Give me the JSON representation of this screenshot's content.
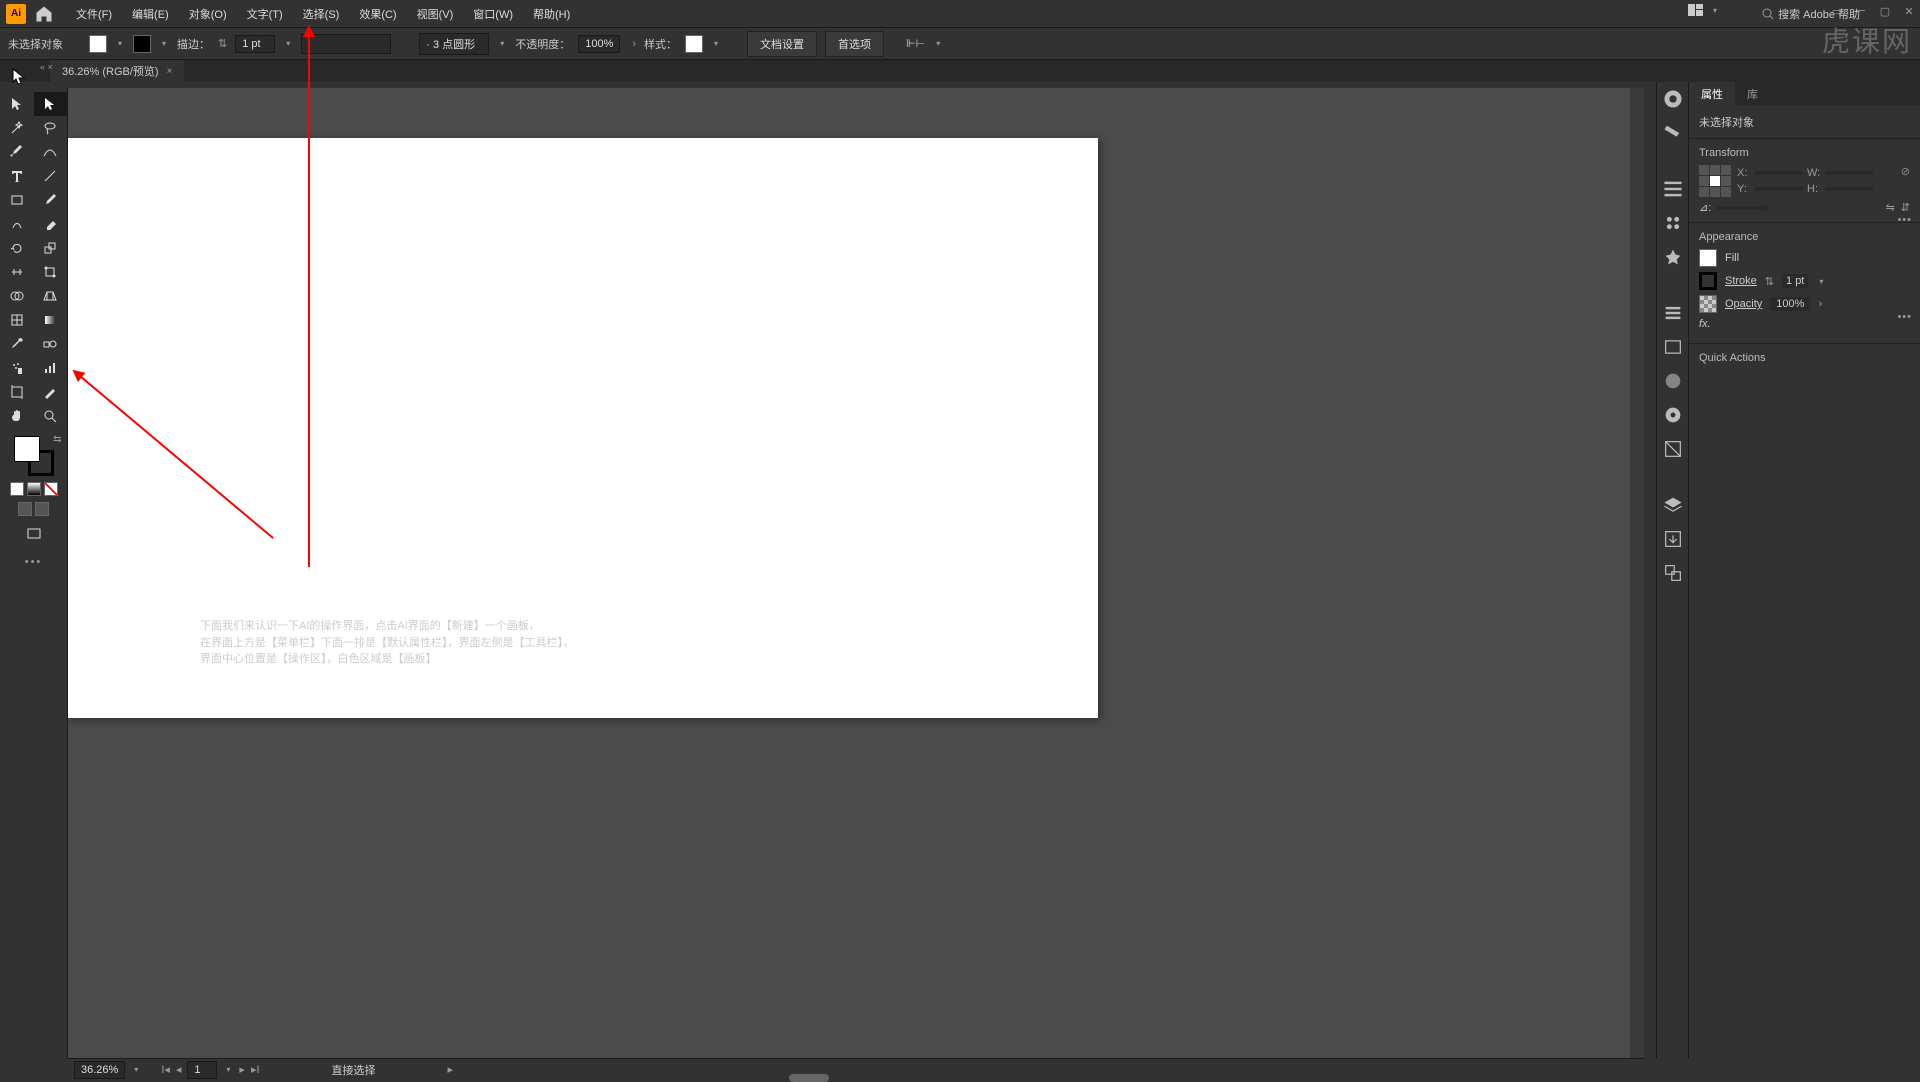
{
  "menu": {
    "file": "文件(F)",
    "edit": "编辑(E)",
    "object": "对象(O)",
    "type": "文字(T)",
    "select": "选择(S)",
    "effect": "效果(C)",
    "view": "视图(V)",
    "window": "窗口(W)",
    "help": "帮助(H)"
  },
  "search": {
    "placeholder": "搜索 Adobe 帮助"
  },
  "watermark": "虎课网",
  "control": {
    "noSel": "未选择对象",
    "stroke": "描边：",
    "strokeVal": "1 pt",
    "brushLabel": "· 3 点圆形",
    "opacity": "不透明度：",
    "opacityVal": "100%",
    "style": "样式：",
    "docSetup": "文档设置",
    "prefs": "首选项"
  },
  "doctab": {
    "title": "36.26% (RGB/预览)"
  },
  "status": {
    "zoom": "36.26%",
    "page": "1",
    "tool": "直接选择"
  },
  "panel": {
    "tabProps": "属性",
    "tabLib": "库",
    "noSel": "未选择对象",
    "transform": "Transform",
    "x": "X:",
    "y": "Y:",
    "w": "W:",
    "h": "H:",
    "angle": "⊿:",
    "appearance": "Appearance",
    "fill": "Fill",
    "strokeL": "Stroke",
    "strokeV": "1 pt",
    "opacityL": "Opacity",
    "opacityV": "100%",
    "fx": "fx.",
    "quick": "Quick Actions"
  },
  "annotation": {
    "l1": "下面我们来认识一下AI的操作界面，点击AI界面的【新建】一个画板，",
    "l2": "在界面上方是【菜单栏】下面一排是【默认属性栏】，界面左侧是【工具栏】，",
    "l3": "界面中心位置是【操作区】，白色区域是【画板】"
  }
}
